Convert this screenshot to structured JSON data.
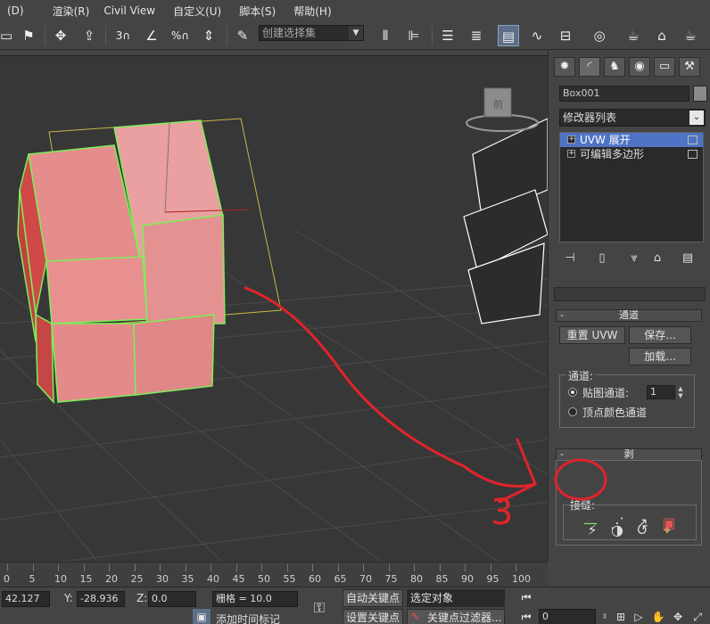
{
  "menu": [
    "(D)",
    "渲染(R)",
    "Civil View",
    "自定义(U)",
    "脚本(S)",
    "帮助(H)"
  ],
  "toolbar": {
    "selection_set_placeholder": "创建选择集",
    "icons": [
      "select-region-icon",
      "move-icon",
      "place-icon",
      "snap-3d-icon",
      "angle-snap-icon",
      "percent-snap-icon",
      "spinner-snap-icon",
      "edit-named-selection-icon",
      "mirror-icon",
      "align-icon",
      "layer-manager-icon",
      "scene-explorer-icon",
      "curve-editor-icon",
      "schematic-view-icon",
      "material-editor-icon",
      "render-setup-icon",
      "render-frame-icon",
      "render-icon"
    ]
  },
  "command_panel": {
    "tabs": [
      "create-tab",
      "modify-tab",
      "hierarchy-tab",
      "motion-tab",
      "display-tab",
      "utilities-tab"
    ],
    "object_name": "Box001",
    "modifier_list": "修改器列表",
    "stack": [
      {
        "label": "UVW 展开",
        "selected": true
      },
      {
        "label": "可编辑多边形",
        "selected": false
      }
    ],
    "channel": {
      "title": "通道",
      "reset_uvw": "重置 UVW",
      "save": "保存...",
      "load": "加载...",
      "group_label": "通道:",
      "map_channel": "贴图通道:",
      "map_channel_value": "1",
      "vertex_color_channel": "顶点颜色通道"
    },
    "peel": {
      "title": "剥",
      "seams_label": "接缝:"
    }
  },
  "timeline": {
    "ticks": [
      "0",
      "5",
      "10",
      "15",
      "20",
      "25",
      "30",
      "35",
      "40",
      "45",
      "50",
      "55",
      "60",
      "65",
      "70",
      "75",
      "80",
      "85",
      "90",
      "95",
      "100"
    ]
  },
  "status": {
    "x_value": "42.127",
    "y_label": "Y:",
    "y_value": "-28.936",
    "z_label": "Z:",
    "z_value": "0.0",
    "grid": "栅格 = 10.0",
    "auto_key": "自动关键点",
    "selected_object": "选定对象",
    "set_key": "设置关键点",
    "key_filters": "关键点过滤器...",
    "add_time_tag": "添加时间标记",
    "frame": "0"
  },
  "annotation_number": "3",
  "colors": {
    "selection_red": "#e25555",
    "active_blue": "#4f74c5",
    "annotation_red": "#e0242a"
  }
}
